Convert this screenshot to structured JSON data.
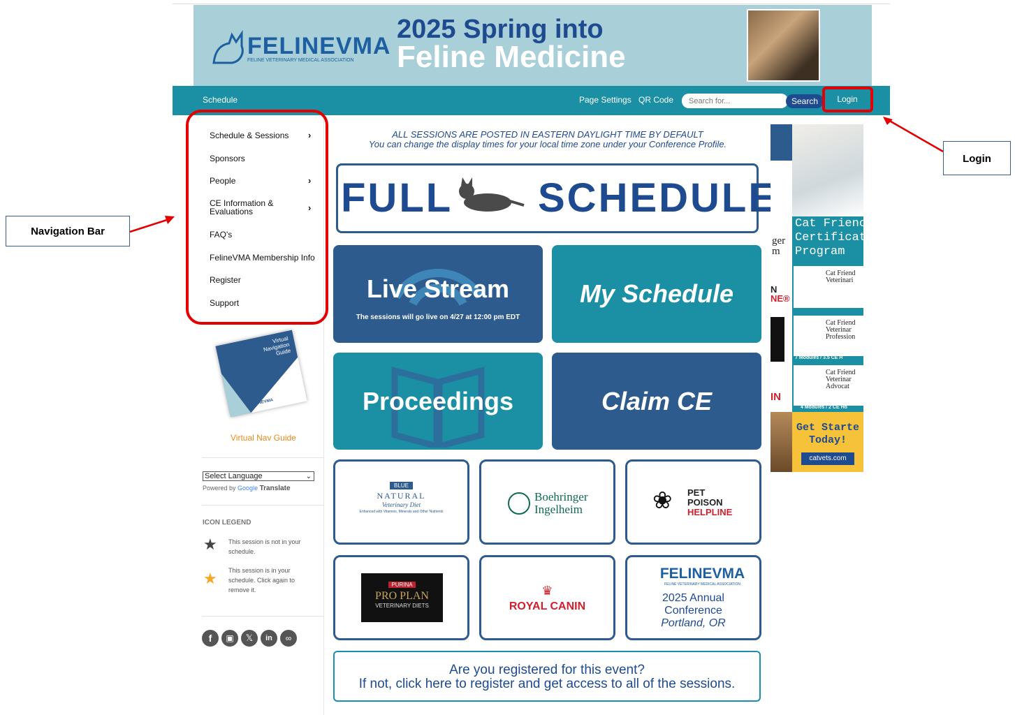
{
  "banner": {
    "brand_name": "FELINEVMA",
    "brand_sub": "FELINE VETERINARY MEDICAL ASSOCIATION",
    "headline_line1": "2025 Spring into",
    "headline_line2": "Feline Medicine"
  },
  "navbar": {
    "schedule_label": "Schedule",
    "page_settings_label": "Page Settings",
    "qr_code_label": "QR Code",
    "search_placeholder": "Search for...",
    "search_button": "Search",
    "login_button": "Login"
  },
  "sidebar": {
    "items": [
      {
        "label": "Schedule & Sessions",
        "has_submenu": true
      },
      {
        "label": "Sponsors",
        "has_submenu": false
      },
      {
        "label": "People",
        "has_submenu": true
      },
      {
        "label": "CE Information &",
        "label2": "Evaluations",
        "has_submenu": true
      },
      {
        "label": "FAQ's",
        "has_submenu": false
      },
      {
        "label": "FelineVMA Membership Info",
        "has_submenu": false
      },
      {
        "label": "Register",
        "has_submenu": false
      },
      {
        "label": "Support",
        "has_submenu": false
      }
    ],
    "guide_thumb_text1": "Virtual",
    "guide_thumb_text2": "Navigation",
    "guide_thumb_text3": "Guide",
    "guide_thumb_brand": "FELINEVMA",
    "guide_link": "Virtual Nav Guide",
    "language_select": "Select Language",
    "powered_by": "Powered by",
    "google": "Google",
    "translate": "Translate",
    "icon_legend_title": "ICON LEGEND",
    "legend_not_in_1": "This session is not in your",
    "legend_not_in_2": "schedule.",
    "legend_in_1": "This session is in your",
    "legend_in_2": "schedule. Click again to",
    "legend_in_3": "remove it.",
    "social": [
      "facebook-icon",
      "instagram-icon",
      "x-icon",
      "linkedin-icon",
      "link-icon"
    ]
  },
  "main": {
    "notice_line1": "ALL SESSIONS ARE POSTED IN EASTERN DAYLIGHT TIME BY DEFAULT",
    "notice_line2": "You can change the display times for your local time zone under your Conference Profile.",
    "full_schedule_left": "FULL",
    "full_schedule_right": "SCHEDULE",
    "tiles": {
      "live_stream": "Live Stream",
      "live_stream_sub": "The sessions will go live on 4/27 at 12:00 pm EDT",
      "my_schedule": "My Schedule",
      "proceedings": "Proceedings",
      "claim_ce": "Claim CE"
    },
    "sponsors": {
      "blue_natural": "NATURAL",
      "blue_word": "BLUE",
      "blue_sub": "Veterinary Diet",
      "blue_tag": "Enhanced with Vitamins, Minerals and Other Nutrients",
      "boehringer_1": "Boehringer",
      "boehringer_2": "Ingelheim",
      "ppl_1": "PET",
      "ppl_2": "POISON",
      "ppl_3": "HELPLINE",
      "purina": "PURINA",
      "pro_plan": "PRO PLAN",
      "vet_diets": "VETERINARY DIETS",
      "royal_canin": "ROYAL CANIN",
      "fvma_brand": "FELINEVMA",
      "fvma_sub": "FELINE VETERINARY MEDICAL ASSOCIATION",
      "fvma_conf_1": "2025 Annual",
      "fvma_conf_2": "Conference",
      "fvma_conf_3": "Portland, OR"
    },
    "register_line1": "Are you registered for this event?",
    "register_line2": "If not, click here to register and get access to all of the sessions."
  },
  "ads": {
    "cat_friendly_1": "Cat Frienc",
    "cat_friendly_2": "Certificat",
    "cat_friendly_3": "Program",
    "module1_title": "Cat Friend Veterinari",
    "module1_sub": "9 Modules / 5 CE Ho",
    "module2_title": "Cat Friend Veterinar Profession",
    "module2_sub": "7 Modules / 3.5 CE H",
    "module3_title": "Cat Friend Veterinar Advocat",
    "module3_sub": "4 Modules / 2 CE Ho",
    "get_started_1": "Get Starte",
    "get_started_2": "Today!",
    "catvets": "catvets.com",
    "left_ad_1": "ger",
    "left_ad_2": "m",
    "left_ad_3": "N",
    "left_ad_4": "NE®",
    "left_ad_5": "IN"
  },
  "annotations": {
    "login_callout": "Login",
    "navigation_callout": "Navigation Bar"
  },
  "colors": {
    "teal": "#1b8fa3",
    "navy": "#2d5b8e",
    "highlight_red": "#e40000",
    "link_orange": "#e88a1a"
  }
}
